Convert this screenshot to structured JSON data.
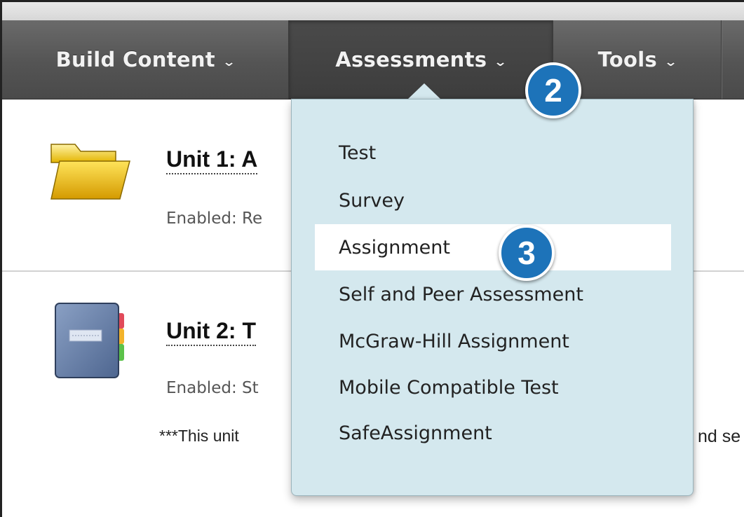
{
  "toolbar": {
    "build_content": "Build Content",
    "assessments": "Assessments",
    "tools": "Tools",
    "chevron": "⌄"
  },
  "assessments_menu": {
    "items": [
      "Test",
      "Survey",
      "Assignment",
      "Self and Peer Assessment",
      "McGraw-Hill Assignment",
      "Mobile Compatible Test",
      "SafeAssignment"
    ],
    "highlighted": "Assignment"
  },
  "content": {
    "unit1": {
      "title": "Unit 1: A",
      "enabled": "Enabled:  Re",
      "icon": "folder-icon"
    },
    "unit2": {
      "title": "Unit 2: T",
      "enabled": "Enabled:  St",
      "description": "***This unit",
      "description_tail": "nd se",
      "icon": "notebook-icon"
    }
  },
  "callouts": {
    "step2": "2",
    "step3": "3"
  },
  "colors": {
    "toolbar": "#545454",
    "menu_background": "#d4e8ee",
    "callout": "#1d73b9",
    "highlight": "#ffffff"
  }
}
